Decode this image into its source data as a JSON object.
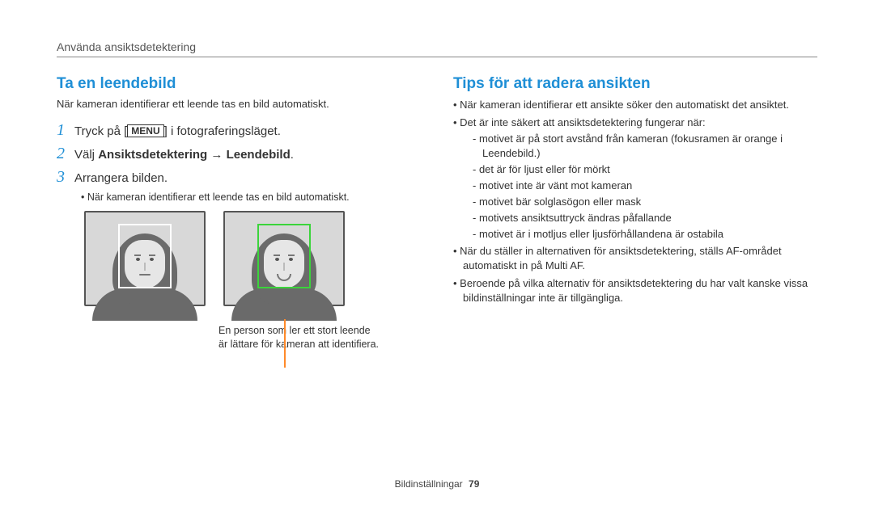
{
  "header": {
    "section": "Använda ansiktsdetektering"
  },
  "left": {
    "title": "Ta en leendebild",
    "intro": "När kameran identifierar ett leende tas en bild automatiskt.",
    "steps": {
      "s1_pre": "Tryck på [",
      "s1_menu": "MENU",
      "s1_post": "] i fotograferingsläget.",
      "s2_pre": "Välj ",
      "s2_bold_a": "Ansiktsdetektering",
      "s2_arrow": " → ",
      "s2_bold_b": "Leendebild",
      "s2_post": ".",
      "s3": "Arrangera bilden."
    },
    "sub_bullet": "När kameran identifierar ett leende tas en bild automatiskt.",
    "caption": "En person som ler ett stort leende är lättare för kameran att identifiera."
  },
  "right": {
    "title": "Tips för att radera ansikten",
    "b1": "När kameran identifierar ett ansikte söker den automatiskt det ansiktet.",
    "b2": "Det är inte säkert att ansiktsdetektering fungerar när:",
    "b2_items": {
      "i1": "motivet är på stort avstånd från kameran (fokusramen är orange i Leendebild.)",
      "i2": "det är för ljust eller för mörkt",
      "i3": "motivet inte är vänt mot kameran",
      "i4": "motivet bär solglasögon eller mask",
      "i5": "motivets ansiktsuttryck ändras påfallande",
      "i6": "motivet är i motljus eller ljusförhållandena är ostabila"
    },
    "b3": "När du ställer in alternativen för ansiktsdetektering, ställs AF-området automatiskt in på Multi AF.",
    "b4": "Beroende på vilka alternativ för ansiktsdetektering du har valt kanske vissa bildinställningar inte är tillgängliga."
  },
  "footer": {
    "label": "Bildinställningar",
    "page": "79"
  }
}
